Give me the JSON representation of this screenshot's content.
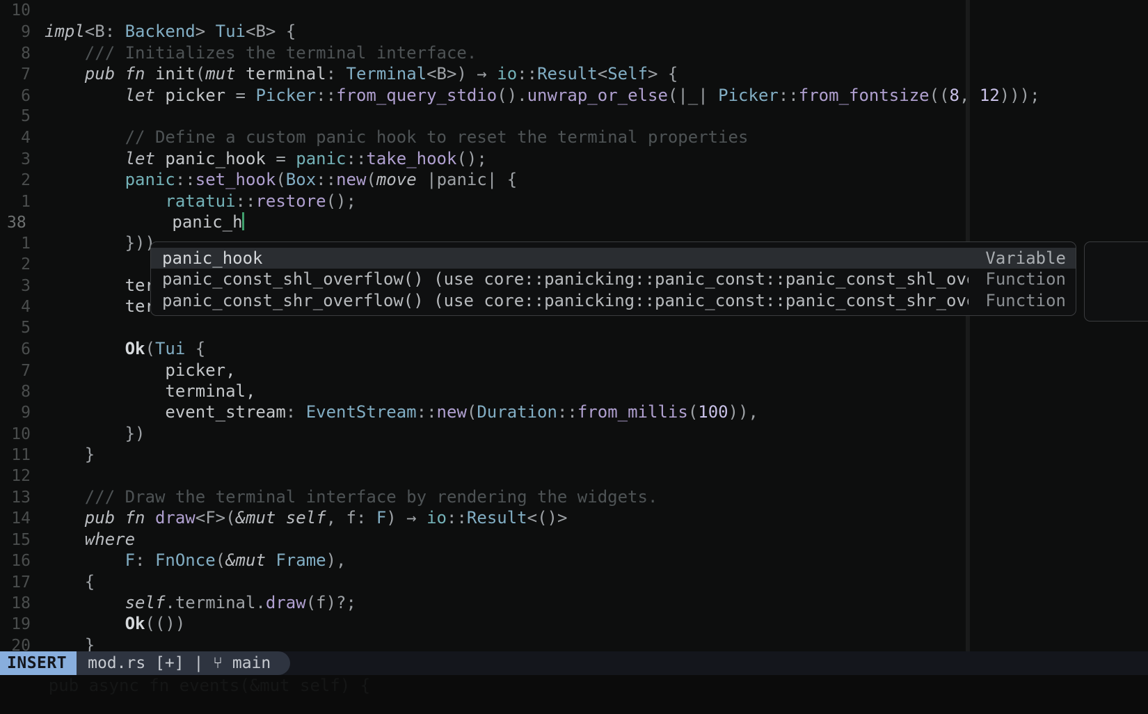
{
  "editor": {
    "language": "rust",
    "background": "#0d0e0e",
    "cursor_color": "#3f9e6c",
    "current_line_number": "38"
  },
  "gutter": {
    "numbers": [
      "10",
      "9",
      "8",
      "7",
      "6",
      "5",
      "4",
      "3",
      "2",
      "1",
      "38",
      "1",
      "2",
      "3",
      "4",
      "5",
      "6",
      "7",
      "8",
      "9",
      "10",
      "11",
      "12",
      "13",
      "14",
      "15",
      "16",
      "17",
      "18",
      "19",
      "20"
    ]
  },
  "code": {
    "lines": [
      {
        "n": "10",
        "current": false,
        "segments": []
      },
      {
        "n": "9",
        "current": false,
        "segments": [
          {
            "t": "impl",
            "c": "kw"
          },
          {
            "t": "<B: ",
            "c": "punc"
          },
          {
            "t": "Backend",
            "c": "type"
          },
          {
            "t": "> ",
            "c": "punc"
          },
          {
            "t": "Tui",
            "c": "type"
          },
          {
            "t": "<B> {",
            "c": "punc"
          }
        ]
      },
      {
        "n": "8",
        "current": false,
        "segments": [
          {
            "t": "    /// Initializes the terminal interface.",
            "c": "cmt"
          }
        ]
      },
      {
        "n": "7",
        "current": false,
        "segments": [
          {
            "t": "    ",
            "c": "plain"
          },
          {
            "t": "pub fn ",
            "c": "kw"
          },
          {
            "t": "init",
            "c": "plain"
          },
          {
            "t": "(",
            "c": "punc"
          },
          {
            "t": "mut ",
            "c": "kw"
          },
          {
            "t": "terminal",
            "c": "plain"
          },
          {
            "t": ": ",
            "c": "punc"
          },
          {
            "t": "Terminal",
            "c": "type"
          },
          {
            "t": "<B>) ",
            "c": "punc"
          },
          {
            "t": "→ ",
            "c": "arrow"
          },
          {
            "t": "io",
            "c": "mod"
          },
          {
            "t": "::",
            "c": "punc"
          },
          {
            "t": "Result",
            "c": "type"
          },
          {
            "t": "<",
            "c": "punc"
          },
          {
            "t": "Self",
            "c": "type"
          },
          {
            "t": "> {",
            "c": "punc"
          }
        ]
      },
      {
        "n": "6",
        "current": false,
        "segments": [
          {
            "t": "        ",
            "c": "plain"
          },
          {
            "t": "let ",
            "c": "kw"
          },
          {
            "t": "picker ",
            "c": "plain"
          },
          {
            "t": "= ",
            "c": "punc"
          },
          {
            "t": "Picker",
            "c": "type"
          },
          {
            "t": "::",
            "c": "punc"
          },
          {
            "t": "from_query_stdio",
            "c": "fnc"
          },
          {
            "t": "().",
            "c": "punc"
          },
          {
            "t": "unwrap_or_else",
            "c": "fnc"
          },
          {
            "t": "(|_| ",
            "c": "punc"
          },
          {
            "t": "Picker",
            "c": "type"
          },
          {
            "t": "::",
            "c": "punc"
          },
          {
            "t": "from_fontsize",
            "c": "fnc"
          },
          {
            "t": "((",
            "c": "punc"
          },
          {
            "t": "8",
            "c": "num"
          },
          {
            "t": ", ",
            "c": "punc"
          },
          {
            "t": "12",
            "c": "num"
          },
          {
            "t": ")));",
            "c": "punc"
          }
        ]
      },
      {
        "n": "5",
        "current": false,
        "segments": []
      },
      {
        "n": "4",
        "current": false,
        "segments": [
          {
            "t": "        // Define a custom panic hook to reset the terminal properties",
            "c": "cmt"
          }
        ]
      },
      {
        "n": "3",
        "current": false,
        "segments": [
          {
            "t": "        ",
            "c": "plain"
          },
          {
            "t": "let ",
            "c": "kw"
          },
          {
            "t": "panic_hook ",
            "c": "plain"
          },
          {
            "t": "= ",
            "c": "punc"
          },
          {
            "t": "panic",
            "c": "mod"
          },
          {
            "t": "::",
            "c": "punc"
          },
          {
            "t": "take_hook",
            "c": "fnc"
          },
          {
            "t": "();",
            "c": "punc"
          }
        ]
      },
      {
        "n": "2",
        "current": false,
        "segments": [
          {
            "t": "        ",
            "c": "plain"
          },
          {
            "t": "panic",
            "c": "mod"
          },
          {
            "t": "::",
            "c": "punc"
          },
          {
            "t": "set_hook",
            "c": "fnc"
          },
          {
            "t": "(",
            "c": "punc"
          },
          {
            "t": "Box",
            "c": "type"
          },
          {
            "t": "::",
            "c": "punc"
          },
          {
            "t": "new",
            "c": "fnc"
          },
          {
            "t": "(",
            "c": "punc"
          },
          {
            "t": "move ",
            "c": "kw"
          },
          {
            "t": "|panic| {",
            "c": "punc"
          }
        ]
      },
      {
        "n": "1",
        "current": false,
        "segments": [
          {
            "t": "            ",
            "c": "plain"
          },
          {
            "t": "ratatui",
            "c": "mod"
          },
          {
            "t": "::",
            "c": "punc"
          },
          {
            "t": "restore",
            "c": "fnc"
          },
          {
            "t": "();",
            "c": "punc"
          }
        ]
      },
      {
        "n": "38",
        "current": true,
        "cursor": true,
        "segments": [
          {
            "t": "            ",
            "c": "plain"
          },
          {
            "t": "panic_h",
            "c": "plain"
          }
        ]
      },
      {
        "n": "1",
        "current": false,
        "segments": [
          {
            "t": "        ",
            "c": "plain"
          },
          {
            "t": "}))",
            "c": "punc"
          }
        ]
      },
      {
        "n": "2",
        "current": false,
        "segments": []
      },
      {
        "n": "3",
        "current": false,
        "segments": [
          {
            "t": "        ",
            "c": "plain"
          },
          {
            "t": "ter",
            "c": "plain"
          }
        ]
      },
      {
        "n": "4",
        "current": false,
        "segments": [
          {
            "t": "        ",
            "c": "plain"
          },
          {
            "t": "ter",
            "c": "plain"
          }
        ]
      },
      {
        "n": "5",
        "current": false,
        "segments": []
      },
      {
        "n": "6",
        "current": false,
        "segments": [
          {
            "t": "        ",
            "c": "plain"
          },
          {
            "t": "Ok",
            "c": "bold"
          },
          {
            "t": "(",
            "c": "punc"
          },
          {
            "t": "Tui",
            "c": "type"
          },
          {
            "t": " {",
            "c": "punc"
          }
        ]
      },
      {
        "n": "7",
        "current": false,
        "segments": [
          {
            "t": "            picker,",
            "c": "plain"
          }
        ]
      },
      {
        "n": "8",
        "current": false,
        "segments": [
          {
            "t": "            terminal,",
            "c": "plain"
          }
        ]
      },
      {
        "n": "9",
        "current": false,
        "segments": [
          {
            "t": "            event_stream",
            "c": "plain"
          },
          {
            "t": ": ",
            "c": "punc"
          },
          {
            "t": "EventStream",
            "c": "type"
          },
          {
            "t": "::",
            "c": "punc"
          },
          {
            "t": "new",
            "c": "fnc"
          },
          {
            "t": "(",
            "c": "punc"
          },
          {
            "t": "Duration",
            "c": "type"
          },
          {
            "t": "::",
            "c": "punc"
          },
          {
            "t": "from_millis",
            "c": "fnc"
          },
          {
            "t": "(",
            "c": "punc"
          },
          {
            "t": "100",
            "c": "num"
          },
          {
            "t": ")),",
            "c": "punc"
          }
        ]
      },
      {
        "n": "10",
        "current": false,
        "segments": [
          {
            "t": "        ",
            "c": "plain"
          },
          {
            "t": "})",
            "c": "punc"
          }
        ]
      },
      {
        "n": "11",
        "current": false,
        "segments": [
          {
            "t": "    ",
            "c": "plain"
          },
          {
            "t": "}",
            "c": "punc"
          }
        ]
      },
      {
        "n": "12",
        "current": false,
        "segments": []
      },
      {
        "n": "13",
        "current": false,
        "segments": [
          {
            "t": "    /// Draw the terminal interface by rendering the widgets.",
            "c": "cmt"
          }
        ]
      },
      {
        "n": "14",
        "current": false,
        "segments": [
          {
            "t": "    ",
            "c": "plain"
          },
          {
            "t": "pub fn ",
            "c": "kw"
          },
          {
            "t": "draw",
            "c": "fnc"
          },
          {
            "t": "<F>(",
            "c": "punc"
          },
          {
            "t": "&mut self",
            "c": "kw"
          },
          {
            "t": ", f: ",
            "c": "punc"
          },
          {
            "t": "F",
            "c": "type"
          },
          {
            "t": ") ",
            "c": "punc"
          },
          {
            "t": "→ ",
            "c": "arrow"
          },
          {
            "t": "io",
            "c": "mod"
          },
          {
            "t": "::",
            "c": "punc"
          },
          {
            "t": "Result",
            "c": "type"
          },
          {
            "t": "<()>",
            "c": "punc"
          }
        ]
      },
      {
        "n": "15",
        "current": false,
        "segments": [
          {
            "t": "    ",
            "c": "plain"
          },
          {
            "t": "where",
            "c": "kw"
          }
        ]
      },
      {
        "n": "16",
        "current": false,
        "segments": [
          {
            "t": "        ",
            "c": "plain"
          },
          {
            "t": "F",
            "c": "type"
          },
          {
            "t": ": ",
            "c": "punc"
          },
          {
            "t": "FnOnce",
            "c": "type"
          },
          {
            "t": "(",
            "c": "punc"
          },
          {
            "t": "&mut ",
            "c": "kw"
          },
          {
            "t": "Frame",
            "c": "type"
          },
          {
            "t": "),",
            "c": "punc"
          }
        ]
      },
      {
        "n": "17",
        "current": false,
        "segments": [
          {
            "t": "    ",
            "c": "plain"
          },
          {
            "t": "{",
            "c": "punc"
          }
        ]
      },
      {
        "n": "18",
        "current": false,
        "segments": [
          {
            "t": "        ",
            "c": "plain"
          },
          {
            "t": "self",
            "c": "kw"
          },
          {
            "t": ".terminal.",
            "c": "punc"
          },
          {
            "t": "draw",
            "c": "fnc"
          },
          {
            "t": "(f)?;",
            "c": "punc"
          }
        ]
      },
      {
        "n": "19",
        "current": false,
        "segments": [
          {
            "t": "        ",
            "c": "plain"
          },
          {
            "t": "Ok",
            "c": "bold"
          },
          {
            "t": "(())",
            "c": "punc"
          }
        ]
      },
      {
        "n": "20",
        "current": false,
        "segments": [
          {
            "t": "    ",
            "c": "plain"
          },
          {
            "t": "}",
            "c": "punc"
          }
        ]
      }
    ]
  },
  "completion": {
    "visible": true,
    "selected_index": 0,
    "items": [
      {
        "label": "panic_hook",
        "detail": "",
        "kind": "Variable",
        "selected": true
      },
      {
        "label": "panic_const_shl_overflow()",
        "detail": "(use core::panicking::panic_const::panic_const_shl_overflow)~",
        "kind": "Function",
        "selected": false
      },
      {
        "label": "panic_const_shr_overflow()",
        "detail": "(use core::panicking::panic_const::panic_const_shr_overflow)~",
        "kind": "Function",
        "selected": false
      }
    ],
    "docs_panel_visible": true
  },
  "statusline": {
    "mode": "INSERT",
    "filename": "mod.rs",
    "modified_flag": "[+]",
    "separator": "|",
    "branch_icon": "⑂",
    "branch": "main",
    "mode_bg": "#88aedd",
    "bar_bg": "#2e3440"
  },
  "bottom_overflow": {
    "text": "    pub async fn events(&mut self) {"
  }
}
